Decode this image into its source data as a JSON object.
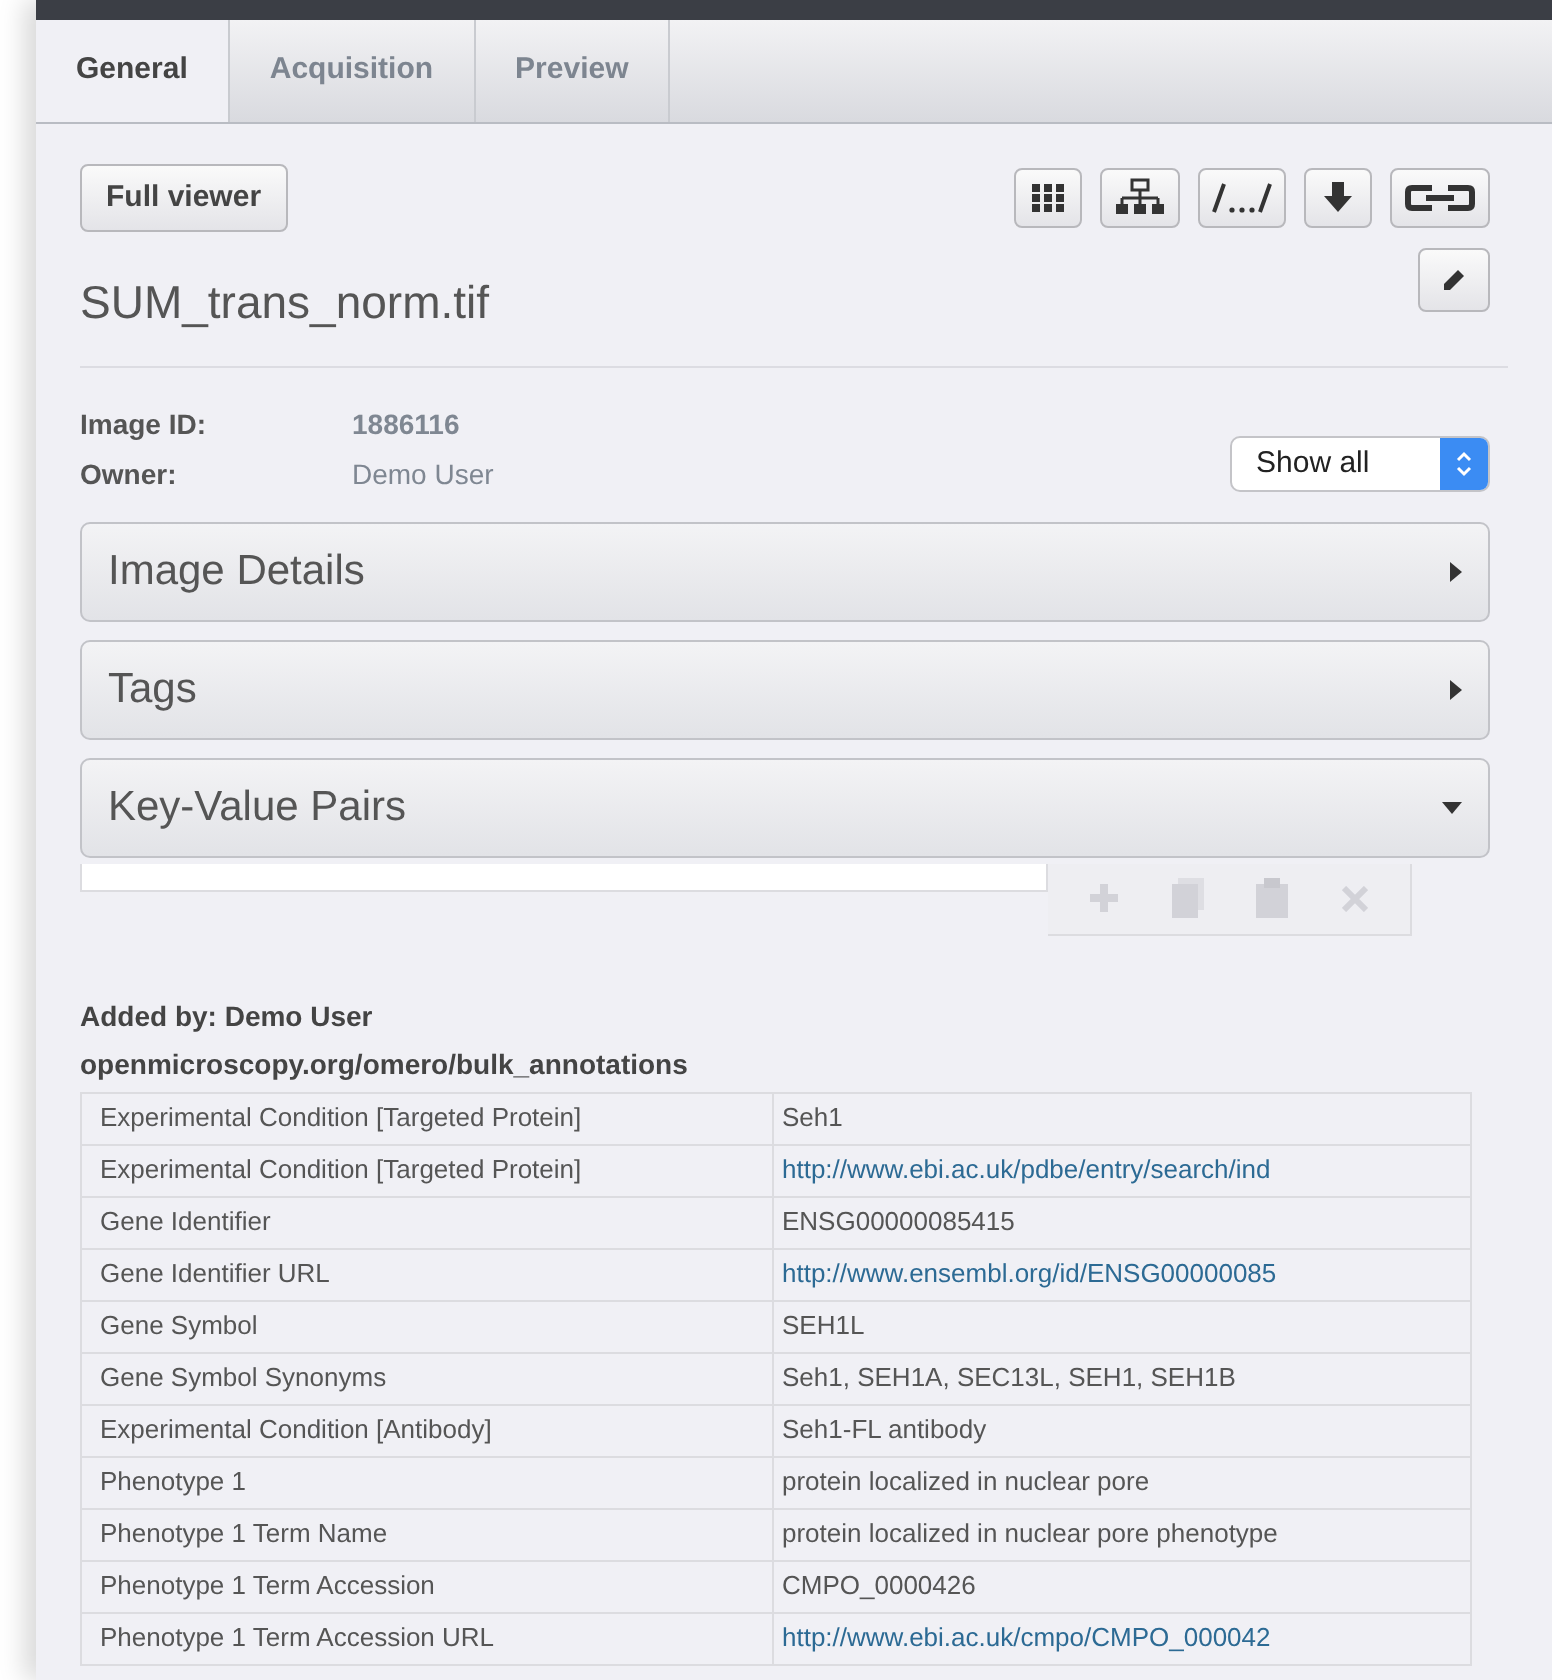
{
  "tabs": [
    {
      "label": "General",
      "selected": true
    },
    {
      "label": "Acquisition",
      "selected": false
    },
    {
      "label": "Preview",
      "selected": false
    }
  ],
  "full_viewer_button": "Full viewer",
  "file_name": "SUM_trans_norm.tif",
  "info": [
    {
      "label": "Image ID:",
      "value": "1886116",
      "bold": true
    },
    {
      "label": "Owner:",
      "value": "Demo User",
      "bold": false
    }
  ],
  "filter_select": {
    "value": "Show all"
  },
  "sections": [
    {
      "title": "Image Details",
      "expanded": false
    },
    {
      "title": "Tags",
      "expanded": false
    },
    {
      "title": "Key-Value Pairs",
      "expanded": true
    }
  ],
  "annotation": {
    "added_by": "Added by: Demo User",
    "namespace": "openmicroscopy.org/omero/bulk_annotations",
    "rows": [
      {
        "key": "Experimental Condition [Targeted Protein]",
        "value": "Seh1",
        "kind": "text"
      },
      {
        "key": "Experimental Condition [Targeted Protein]",
        "value": "http://www.ebi.ac.uk/pdbe/entry/search/ind",
        "kind": "link"
      },
      {
        "key": "Gene Identifier",
        "value": "ENSG00000085415",
        "kind": "text"
      },
      {
        "key": "Gene Identifier URL",
        "value": "http://www.ensembl.org/id/ENSG00000085",
        "kind": "link"
      },
      {
        "key": "Gene Symbol",
        "value": "SEH1L",
        "kind": "text"
      },
      {
        "key": "Gene Symbol Synonyms",
        "value": "Seh1, SEH1A, SEC13L, SEH1, SEH1B",
        "kind": "text"
      },
      {
        "key": "Experimental Condition [Antibody]",
        "value": "Seh1-FL antibody",
        "kind": "text"
      },
      {
        "key": "Phenotype 1",
        "value": "protein localized in nuclear pore",
        "kind": "text"
      },
      {
        "key": "Phenotype 1 Term Name",
        "value": "protein localized in nuclear pore phenotype",
        "kind": "text"
      },
      {
        "key": "Phenotype 1 Term Accession",
        "value": "CMPO_0000426",
        "kind": "text"
      },
      {
        "key": "Phenotype 1 Term Accession URL",
        "value": "http://www.ebi.ac.uk/cmpo/CMPO_000042",
        "kind": "link"
      }
    ]
  }
}
